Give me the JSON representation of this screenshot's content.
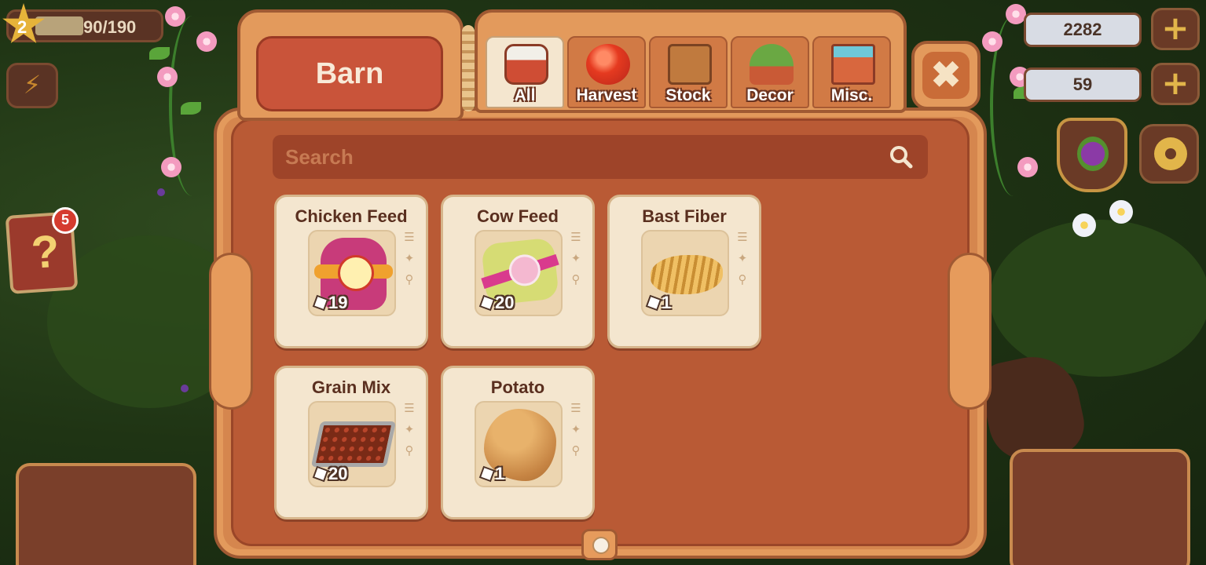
{
  "hud": {
    "level": "2",
    "xp": "90/190",
    "xp_progress": 0.47,
    "coins": "2282",
    "gems": "59",
    "quest_badge": "5"
  },
  "dialog": {
    "title": "Barn",
    "tabs": [
      {
        "label": "All",
        "icon": "barn-crate-icon",
        "active": true
      },
      {
        "label": "Harvest",
        "icon": "tomato-icon",
        "active": false
      },
      {
        "label": "Stock",
        "icon": "toolbox-icon",
        "active": false
      },
      {
        "label": "Decor",
        "icon": "cactus-pot-icon",
        "active": false
      },
      {
        "label": "Misc.",
        "icon": "crystal-crate-icon",
        "active": false
      }
    ],
    "search": {
      "placeholder": "Search",
      "value": ""
    },
    "items": [
      {
        "name": "Chicken Feed",
        "qty": "19"
      },
      {
        "name": "Cow Feed",
        "qty": "20"
      },
      {
        "name": "Bast Fiber",
        "qty": "1"
      },
      {
        "name": "Grain Mix",
        "qty": "20"
      },
      {
        "name": "Potato",
        "qty": "1"
      }
    ]
  },
  "colors": {
    "frame": "#d5864e",
    "panel": "#b95a35",
    "card": "#f4e6cf",
    "title_plate": "#c9543a"
  }
}
